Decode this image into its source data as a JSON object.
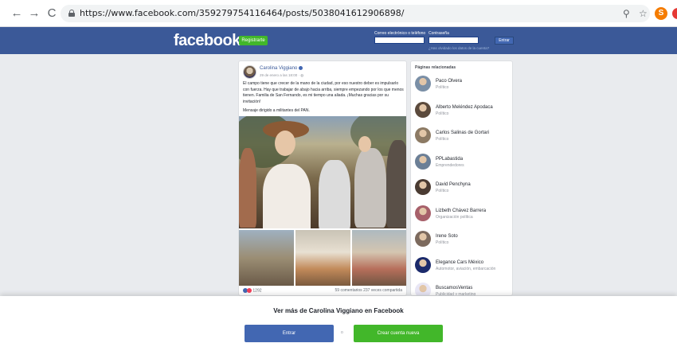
{
  "browser": {
    "back": "←",
    "forward": "→",
    "reload": "C",
    "url_prefix": "https://www.facebook.com",
    "url_path": "/359279754116464/posts/5038041612906898/",
    "zoom_icon": "zoom-icon",
    "star_icon": "star-icon",
    "profile_initial": "S"
  },
  "header": {
    "logo": "facebook",
    "register": "Registrarte",
    "email_label": "Correo electrónico o teléfono",
    "password_label": "Contraseña",
    "forgot": "¿Has olvidado los datos de la cuenta?",
    "login": "Entrar"
  },
  "post": {
    "author": "Carolina Viggiano",
    "time": "29 de enero a las 18:00 · ",
    "text": "El campo tiene que crecer de la mano de la ciudad, por eso nuestro deber es impulsarlo con fuerza. Hay que trabajar de abajo hacia arriba, siempre empezando por los que menos tienen. Familia de San Fernando, es mi tiempo una aliada. ¡Muchas gracias por su invitación!",
    "text2": "Mensaje dirigido a militantes del PAN.",
    "reactions": "1292",
    "stats": "59 comentarios  237 veces compartida"
  },
  "related": {
    "title": "Páginas relacionadas",
    "items": [
      {
        "name": "Paco Olvera",
        "category": "Político",
        "color": "#7a8fa6"
      },
      {
        "name": "Alberto Meléndez Apodaca",
        "category": "Político",
        "color": "#5b4a3c"
      },
      {
        "name": "Carlos Salinas de Gortari",
        "category": "Político",
        "color": "#8c7a64"
      },
      {
        "name": "PPLabastida",
        "category": "Emprendedores",
        "color": "#6b7f96"
      },
      {
        "name": "David Penchyna",
        "category": "Político",
        "color": "#4a3b32"
      },
      {
        "name": "Lizbeth Chávez Barrera",
        "category": "Organización política",
        "color": "#a7606a"
      },
      {
        "name": "Irene Soto",
        "category": "Político",
        "color": "#7c6a5e"
      },
      {
        "name": "Elegance Cars México",
        "category": "Automotor, aviación, embarcación",
        "color": "#1b2a6b"
      },
      {
        "name": "BuscamosVentas",
        "category": "Publicidad y marketing",
        "color": "#e8e6f5"
      }
    ]
  },
  "footer": {
    "see_more": "Ver más de Carolina Viggiano en Facebook",
    "login": "Entrar",
    "or": "o",
    "create": "Crear cuenta nueva"
  },
  "colors": {
    "fb_blue": "#3b5998",
    "green": "#42b72a",
    "button_blue": "#4267b2"
  }
}
